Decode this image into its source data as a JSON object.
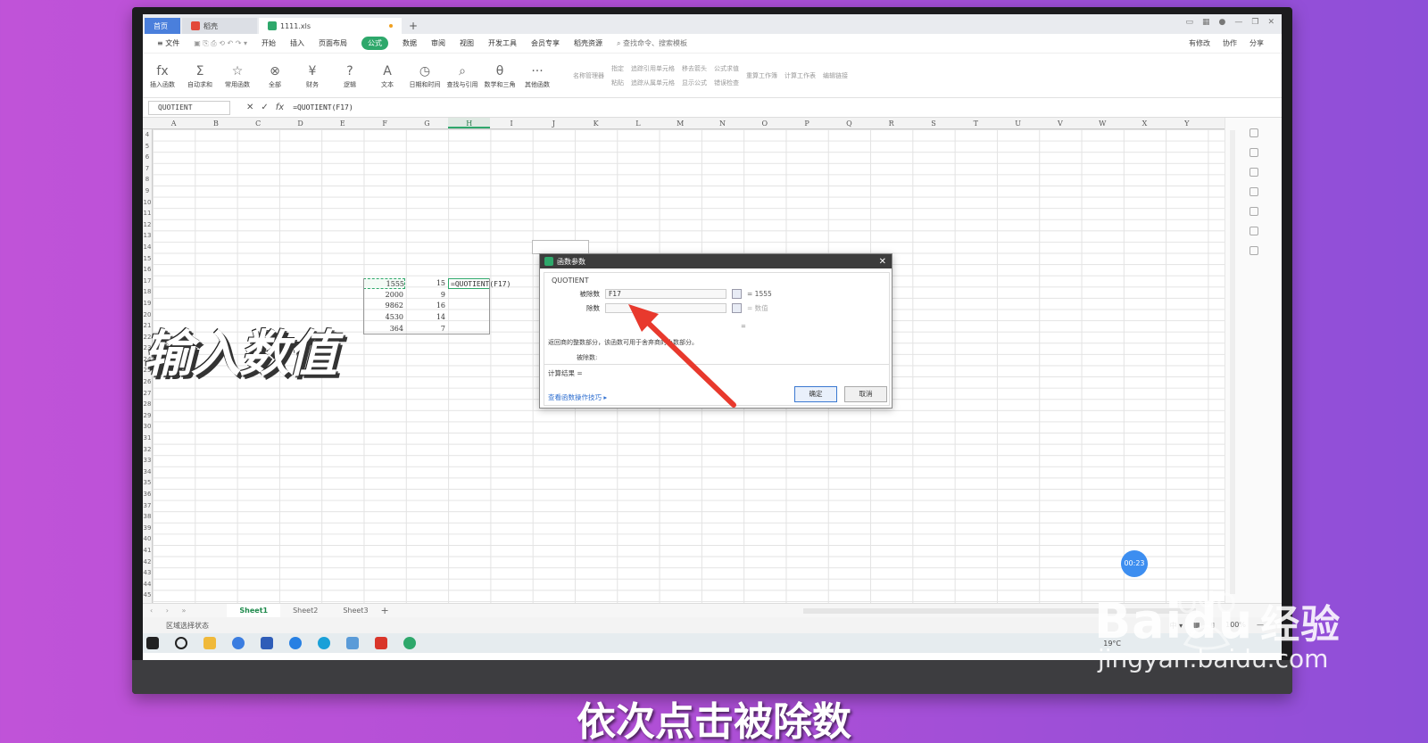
{
  "tabs": {
    "home": "首页",
    "docer": "稻壳",
    "file": "1111.xls",
    "add": "+"
  },
  "menu": {
    "file": "≡ 文件",
    "items": [
      "开始",
      "插入",
      "页面布局",
      "公式",
      "数据",
      "审阅",
      "视图",
      "开发工具",
      "会员专享",
      "稻壳资源"
    ],
    "active": "公式",
    "search": "查找命令、搜索模板",
    "right": [
      "有修改",
      "协作",
      "分享"
    ]
  },
  "ribbon": {
    "buttons": [
      {
        "icon": "fx",
        "label": "插入函数"
      },
      {
        "icon": "Σ",
        "label": "自动求和"
      },
      {
        "icon": "☆",
        "label": "常用函数"
      },
      {
        "icon": "⊗",
        "label": "全部"
      },
      {
        "icon": "¥",
        "label": "财务"
      },
      {
        "icon": "?",
        "label": "逻辑"
      },
      {
        "icon": "A",
        "label": "文本"
      },
      {
        "icon": "◷",
        "label": "日期和时间"
      },
      {
        "icon": "⌕",
        "label": "查找与引用"
      },
      {
        "icon": "θ",
        "label": "数学和三角"
      },
      {
        "icon": "···",
        "label": "其他函数"
      }
    ],
    "small_groups": [
      [
        "名称管理器"
      ],
      [
        "指定",
        "粘贴"
      ],
      [
        "追踪引用单元格",
        "追踪从属单元格"
      ],
      [
        "移去箭头",
        "显示公式"
      ],
      [
        "公式求值",
        "错误检查"
      ],
      [
        "重算工作簿"
      ],
      [
        "计算工作表"
      ],
      [
        "编辑链接"
      ]
    ]
  },
  "formula_bar": {
    "name_box": "QUOTIENT",
    "content": "=QUOTIENT(F17)"
  },
  "columns": [
    "A",
    "B",
    "C",
    "D",
    "E",
    "F",
    "G",
    "H",
    "I",
    "J",
    "K",
    "L",
    "M",
    "N",
    "O",
    "P",
    "Q",
    "R",
    "S",
    "T",
    "U",
    "V",
    "W",
    "X",
    "Y"
  ],
  "selected_column": "H",
  "rows": [
    "4",
    "5",
    "6",
    "7",
    "8",
    "9",
    "10",
    "11",
    "12",
    "13",
    "14",
    "15",
    "16",
    "17",
    "18",
    "19",
    "20",
    "21",
    "22",
    "23",
    "24",
    "25",
    "26",
    "27",
    "28",
    "29",
    "30",
    "31",
    "32",
    "33",
    "34",
    "35",
    "36",
    "37",
    "38",
    "39",
    "40",
    "41",
    "42",
    "43",
    "44",
    "45"
  ],
  "cells": {
    "f17": "1555",
    "g17": "15",
    "h17": "=QUOTIENT(F17)",
    "f18": "2000",
    "g18": "9",
    "f19": "9862",
    "g19": "16",
    "f20": "4530",
    "g20": "14",
    "f21": "364",
    "g21": "7"
  },
  "dialog": {
    "title": "函数参数",
    "function_name": "QUOTIENT",
    "arg1_label": "被除数",
    "arg1_value": "F17",
    "arg1_result": "= 1555",
    "arg2_label": "除数",
    "arg2_value": "",
    "arg2_result": "= 数值",
    "total": "=",
    "description": "返回商的整数部分，该函数可用于舍弃商的小数部分。",
    "arg_desc": "被除数:",
    "calc_result": "计算结果 =",
    "help_link": "查看函数操作技巧",
    "ok": "确定",
    "cancel": "取消"
  },
  "sheets": [
    "Sheet1",
    "Sheet2",
    "Sheet3"
  ],
  "active_sheet": "Sheet1",
  "status": {
    "left": "区域选择状态",
    "zoom": "100%"
  },
  "taskbar": {
    "weather": "19°C"
  },
  "overlay": {
    "big_text": "输入数值",
    "timer": "00:23",
    "subtitle": "依次点击被除数",
    "watermark_brand": "Baidu",
    "watermark_cn": "经验",
    "watermark_url": "jingyan.baidu.com"
  },
  "colors": {
    "accent_green": "#2ea86b",
    "arrow_red": "#e8392d",
    "background": "#b04fd6"
  }
}
